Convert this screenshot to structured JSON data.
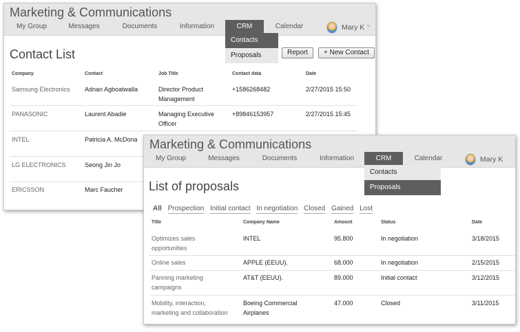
{
  "app_title": "Marketing & Communications",
  "nav": [
    "My Group",
    "Messages",
    "Documents",
    "Information",
    "CRM",
    "Calendar"
  ],
  "user": {
    "name": "Mary K"
  },
  "crm_menu": [
    "Contacts",
    "Proposals"
  ],
  "contacts_window": {
    "title": "Contact List",
    "report_button": "Report",
    "new_contact_button": "+ New Contact",
    "headers": [
      "Company",
      "Contact",
      "Job Title",
      "Contact data",
      "Date"
    ],
    "rows": [
      [
        "Samsung Electronics",
        "Adnan Agboatwalla",
        "Director Product\nManagement",
        "+1586268482",
        "2/27/2015 15:50"
      ],
      [
        "PANASONIC",
        "Laurent Abadie",
        "Managing Executive\nOfficer",
        "+89846153957",
        "2/27/2015 15:45"
      ],
      [
        "INTEL",
        "Patricia A. McDona",
        "",
        "",
        ""
      ],
      [
        "LG ELECTRONICS",
        "Seong Jin Jo",
        "",
        "",
        ""
      ],
      [
        "ERICSSON",
        "Marc Faucher",
        "",
        "",
        ""
      ]
    ]
  },
  "proposals_window": {
    "title": "List of proposals",
    "filters": [
      "All",
      "Prospection",
      "Initial contact",
      "In negotiation",
      "Closed",
      "Gained",
      "Lost"
    ],
    "headers": [
      "Title",
      "Company Name",
      "Amount",
      "Status",
      "Date"
    ],
    "rows": [
      [
        "Optimizes sales\nopportunities",
        "INTEL",
        "95.800",
        "In negotiation",
        "3/18/2015"
      ],
      [
        "Online sales",
        "APPLE (EEUU).",
        "68.000",
        "In negotiation",
        "2/15/2015"
      ],
      [
        "Panning marketing\ncampaigns",
        "AT&T (EEUU).",
        "89.000",
        "Initial contact",
        "3/12/2015"
      ],
      [
        "Mobility, interaction,\nmarketing and collaboration",
        "Boeing Commercial\nAirplanes",
        "47.000",
        "Closed",
        "3/11/2015"
      ]
    ]
  }
}
